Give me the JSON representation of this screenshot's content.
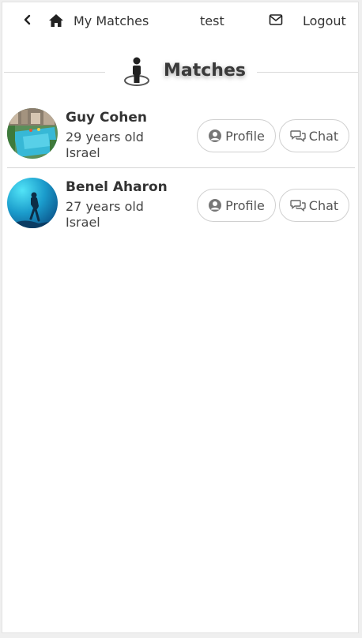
{
  "nav": {
    "my_matches_label": "My Matches",
    "username": "test",
    "logout_label": "Logout"
  },
  "page": {
    "heading": "Matches"
  },
  "matches": [
    {
      "name": "Guy Cohen",
      "age": "29 years old",
      "country": "Israel",
      "profile_label": "Profile",
      "chat_label": "Chat"
    },
    {
      "name": "Benel Aharon",
      "age": "27 years old",
      "country": "Israel",
      "profile_label": "Profile",
      "chat_label": "Chat"
    }
  ],
  "icons": {
    "back": "chevron-left-icon",
    "home": "home-icon",
    "mail": "envelope-icon",
    "heading": "person-standing-icon",
    "profile": "user-circle-icon",
    "chat": "comments-icon"
  }
}
